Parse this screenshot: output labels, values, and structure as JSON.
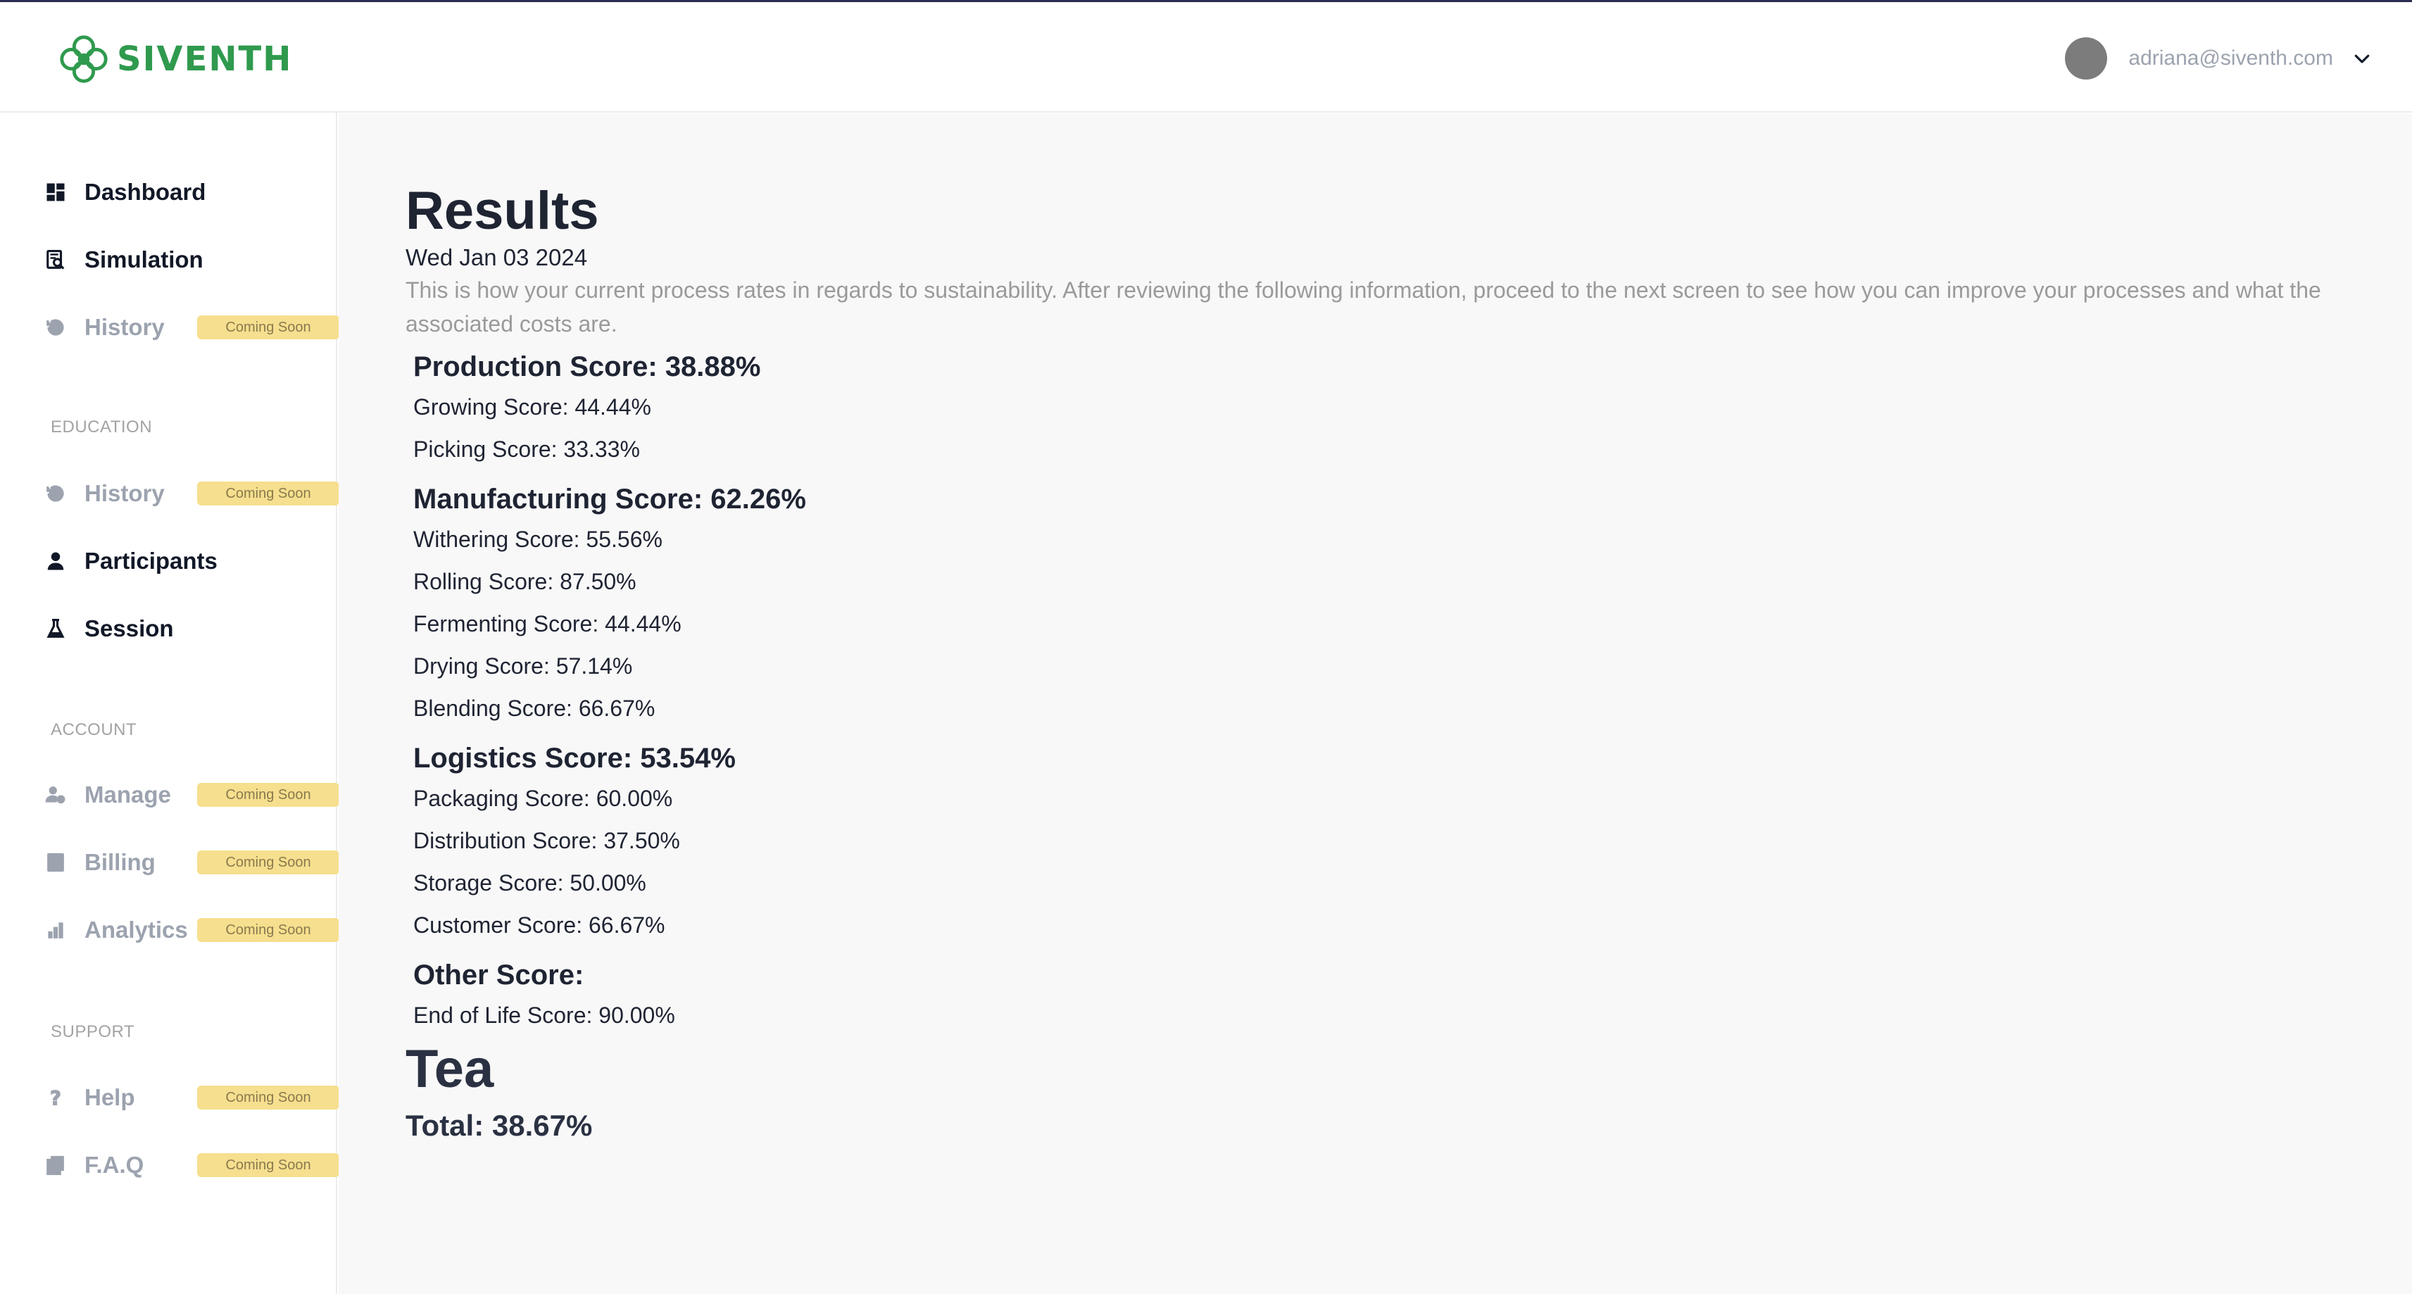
{
  "brand": {
    "name": "SIVENTH",
    "color": "#2f9a4e"
  },
  "user": {
    "email": "adriana@siventh.com"
  },
  "sidebar": {
    "main": [
      {
        "label": "Dashboard",
        "icon": "dashboard-icon"
      },
      {
        "label": "Simulation",
        "icon": "simulation-icon"
      },
      {
        "label": "History",
        "icon": "history-icon",
        "badge": "Coming Soon"
      }
    ],
    "education": {
      "label": "EDUCATION",
      "items": [
        {
          "label": "History",
          "icon": "history-icon",
          "badge": "Coming Soon"
        },
        {
          "label": "Participants",
          "icon": "person-icon"
        },
        {
          "label": "Session",
          "icon": "flask-icon"
        }
      ]
    },
    "account": {
      "label": "ACCOUNT",
      "items": [
        {
          "label": "Manage",
          "icon": "manage-users-icon",
          "badge": "Coming Soon"
        },
        {
          "label": "Billing",
          "icon": "billing-icon",
          "badge": "Coming Soon"
        },
        {
          "label": "Analytics",
          "icon": "bar-chart-icon",
          "badge": "Coming Soon"
        }
      ]
    },
    "support": {
      "label": "SUPPORT",
      "items": [
        {
          "label": "Help",
          "icon": "question-icon",
          "badge": "Coming Soon"
        },
        {
          "label": "F.A.Q",
          "icon": "faq-icon",
          "badge": "Coming Soon"
        }
      ]
    }
  },
  "results": {
    "title": "Results",
    "date": "Wed Jan 03 2024",
    "description": "This is how your current process rates in regards to sustainability. After reviewing the following information, proceed to the next screen to see how you can improve your processes and what the associated costs are.",
    "production": {
      "heading": "Production Score: 38.88%",
      "items": [
        "Growing Score: 44.44%",
        "Picking Score: 33.33%"
      ]
    },
    "manufacturing": {
      "heading": "Manufacturing Score: 62.26%",
      "items": [
        "Withering Score: 55.56%",
        "Rolling Score: 87.50%",
        "Fermenting Score: 44.44%",
        "Drying Score: 57.14%",
        "Blending Score: 66.67%"
      ]
    },
    "logistics": {
      "heading": "Logistics Score: 53.54%",
      "items": [
        "Packaging Score: 60.00%",
        "Distribution Score: 37.50%",
        "Storage Score: 50.00%",
        "Customer Score: 66.67%"
      ]
    },
    "other": {
      "heading": "Other Score:",
      "items": [
        "End of Life Score: 90.00%"
      ]
    },
    "product": "Tea",
    "total": "Total: 38.67%"
  }
}
